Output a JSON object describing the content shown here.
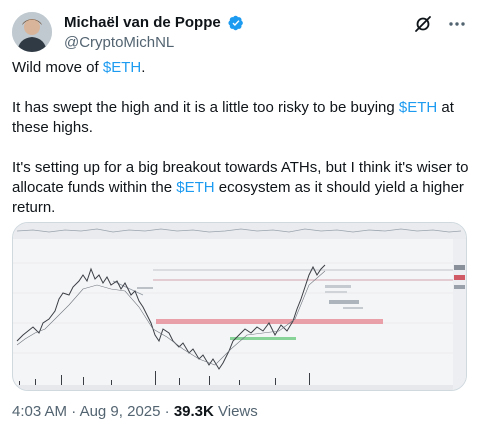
{
  "author": {
    "display_name": "Michaël van de Poppe",
    "handle": "@CryptoMichNL",
    "verified": true,
    "verified_color": "#1d9bf0"
  },
  "actions": {
    "grok_icon": "grok-icon",
    "more_icon": "more-icon"
  },
  "tweet": {
    "line1_pre": "Wild move of ",
    "line1_tag": "$ETH",
    "line1_post": ".",
    "p2_pre": "It has swept the high and it is a little too risky to be buying ",
    "p2_tag": "$ETH",
    "p2_post": " at these highs.",
    "p3_pre": "It's setting up for a big breakout towards ATHs, but I think it's wiser to allocate funds within the ",
    "p3_tag": "$ETH",
    "p3_post": " ecosystem as it should yield a higher return.",
    "cashtag_color": "#1d9bf0"
  },
  "media": {
    "kind": "chart screenshot (ETH price chart with support/resistance zones)",
    "zone_color_red": "#e8909a",
    "zone_color_green": "#7ccf8c"
  },
  "meta": {
    "time": "4:03 AM",
    "sep1": " · ",
    "date": "Aug 9, 2025",
    "sep2": " · ",
    "views_count": "39.3K",
    "views_label": " Views"
  }
}
